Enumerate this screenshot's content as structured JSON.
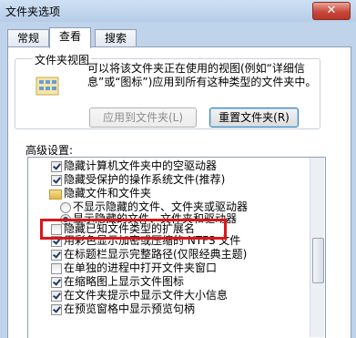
{
  "window": {
    "title": "文件夹选项",
    "close_glyph": "✕"
  },
  "tabs": [
    {
      "label": "常规",
      "active": false
    },
    {
      "label": "查看",
      "active": true
    },
    {
      "label": "搜索",
      "active": false
    }
  ],
  "folder_views": {
    "title": "文件夹视图",
    "description": "可以将该文件夹正在使用的视图(例如“详细信息”或“图标”)应用到所有这种类型的文件夹中。",
    "apply_button": "应用到文件夹(L)",
    "reset_button": "重置文件夹(R)"
  },
  "advanced": {
    "label": "高级设置:",
    "items": [
      {
        "type": "checkbox",
        "checked": true,
        "label": "隐藏计算机文件夹中的空驱动器"
      },
      {
        "type": "checkbox",
        "checked": true,
        "label": "隐藏受保护的操作系统文件(推荐)"
      },
      {
        "type": "folder",
        "label": "隐藏文件和文件夹"
      },
      {
        "type": "radio",
        "checked": false,
        "label": "不显示隐藏的文件、文件夹或驱动器"
      },
      {
        "type": "radio",
        "checked": true,
        "label": "显示隐藏的文件、文件夹和驱动器"
      },
      {
        "type": "checkbox",
        "checked": false,
        "label": "隐藏已知文件类型的扩展名"
      },
      {
        "type": "checkbox",
        "checked": true,
        "label": "用彩色显示加密或压缩的 NTFS 文件"
      },
      {
        "type": "checkbox",
        "checked": true,
        "label": "在标题栏显示完整路径(仅限经典主题)"
      },
      {
        "type": "checkbox",
        "checked": false,
        "label": "在单独的进程中打开文件夹窗口"
      },
      {
        "type": "checkbox",
        "checked": true,
        "label": "在缩略图上显示文件图标"
      },
      {
        "type": "checkbox",
        "checked": true,
        "label": "在文件夹提示中显示文件大小信息"
      },
      {
        "type": "checkbox",
        "checked": true,
        "label": "在预览窗格中显示预览句柄"
      }
    ]
  },
  "colors": {
    "highlight": "#d9161c",
    "window_frame": "#bfd3ea"
  }
}
